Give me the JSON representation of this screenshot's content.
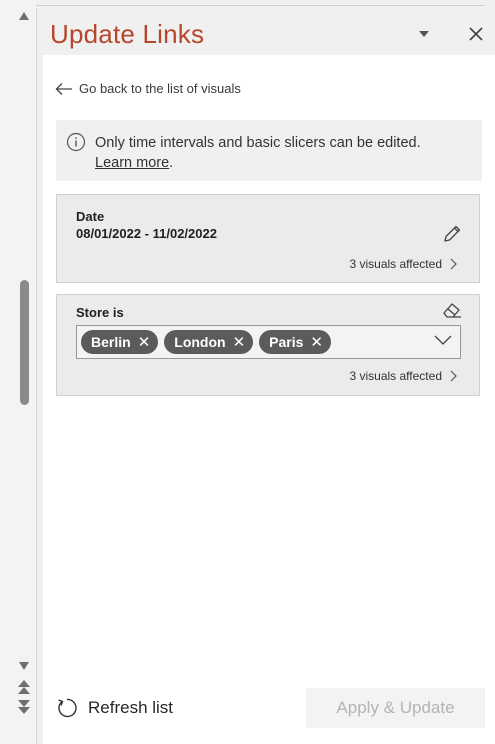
{
  "pane": {
    "title": "Update Links",
    "back_link": "Go back to the list of visuals",
    "info": {
      "message": "Only time intervals and basic slicers can be edited.",
      "learn_more": "Learn more",
      "period": "."
    },
    "date_card": {
      "label": "Date",
      "range": "08/01/2022 - 11/02/2022",
      "affected": "3 visuals affected"
    },
    "store_card": {
      "label": "Store is",
      "chips": [
        "Berlin",
        "London",
        "Paris"
      ],
      "affected": "3 visuals affected"
    },
    "footer": {
      "refresh_label": "Refresh list",
      "apply_label": "Apply & Update"
    }
  },
  "colors": {
    "title": "#b7472a",
    "chip": "#5b5b5b",
    "disabled_text": "#b4b4b4"
  }
}
